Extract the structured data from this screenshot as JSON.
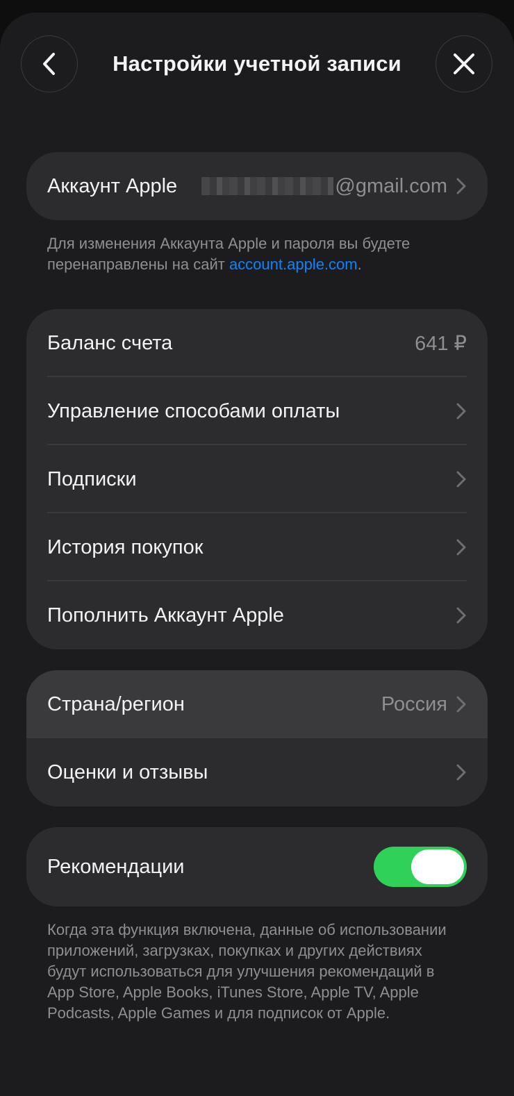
{
  "header": {
    "title": "Настройки учетной записи"
  },
  "account": {
    "label": "Аккаунт Apple",
    "email_suffix": "@gmail.com",
    "note_text": "Для изменения Аккаунта Apple и пароля вы будете перенаправлены на сайт ",
    "note_link": "account.apple.com",
    "note_end": "."
  },
  "payments": {
    "balance_label": "Баланс счета",
    "balance_value": "641 ₽",
    "methods_label": "Управление способами оплаты",
    "subscriptions_label": "Подписки",
    "history_label": "История покупок",
    "topup_label": "Пополнить Аккаунт Apple"
  },
  "region": {
    "country_label": "Страна/регион",
    "country_value": "Россия",
    "ratings_label": "Оценки и отзывы"
  },
  "recommendations": {
    "label": "Рекомендации",
    "enabled": true,
    "note": "Когда эта функция включена, данные об использовании приложений, загрузках, покупках и других действиях будут использоваться для улучшения рекомендаций в App Store, Apple Books, iTunes Store, Apple TV, Apple Podcasts, Apple Games и для подписок от Apple."
  },
  "colors": {
    "accent": "#0a84ff",
    "toggle_on": "#30d158",
    "background": "#1c1c1e",
    "card": "#2c2c2e"
  }
}
